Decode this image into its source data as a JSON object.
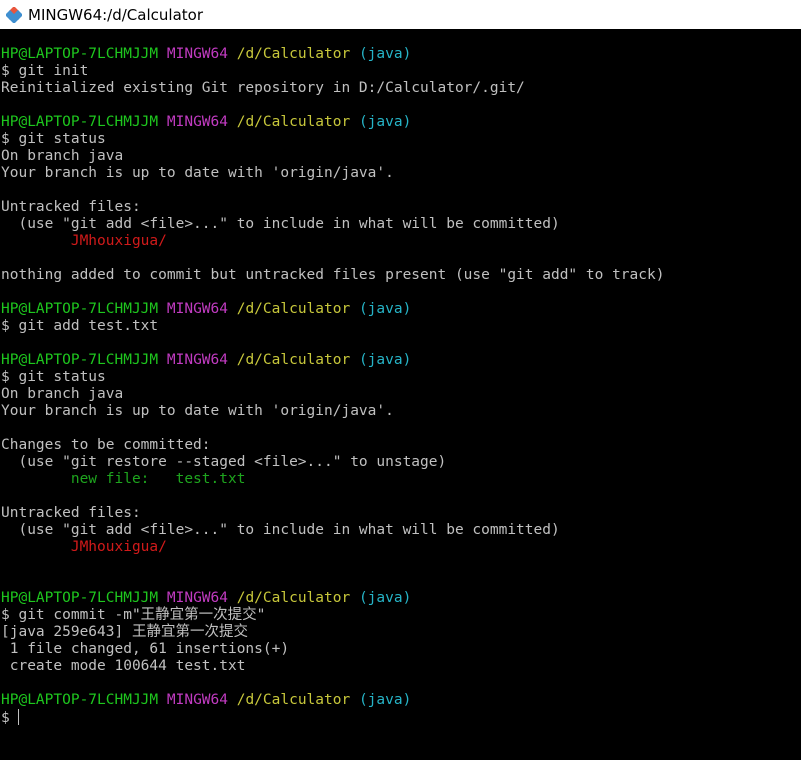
{
  "window": {
    "title": "MINGW64:/d/Calculator",
    "icon": "git-bash-icon"
  },
  "colors": {
    "user": "#1ec71e",
    "system": "#c13bc1",
    "path": "#c7c73b",
    "branch": "#26b4c7",
    "untracked": "#d11a1a",
    "staged": "#1ea51e",
    "text": "#c0c0c0",
    "background": "#000000"
  },
  "prompt": {
    "user": "HP@LAPTOP-7LCHMJJM",
    "system": "MINGW64",
    "path": "/d/Calculator",
    "branch": "(java)"
  },
  "terminal": {
    "cmd_init": "$ git init",
    "out_init": "Reinitialized existing Git repository in D:/Calculator/.git/",
    "cmd_status1": "$ git status",
    "out_on_branch": "On branch java",
    "out_up_to_date": "Your branch is up to date with 'origin/java'.",
    "untracked_header": "Untracked files:",
    "untracked_hint": "  (use \"git add <file>...\" to include in what will be committed)",
    "untracked_file": "        JMhouxigua/",
    "nothing_added": "nothing added to commit but untracked files present (use \"git add\" to track)",
    "cmd_add": "$ git add test.txt",
    "cmd_status2": "$ git status",
    "changes_header": "Changes to be committed:",
    "restore_hint": "  (use \"git restore --staged <file>...\" to unstage)",
    "new_file": "        new file:   test.txt",
    "cmd_commit": "$ git commit -m\"王静宜第一次提交\"",
    "commit_result": "[java 259e643] 王静宜第一次提交",
    "commit_stats": " 1 file changed, 61 insertions(+)",
    "commit_mode": " create mode 100644 test.txt",
    "final_prompt": "$"
  }
}
